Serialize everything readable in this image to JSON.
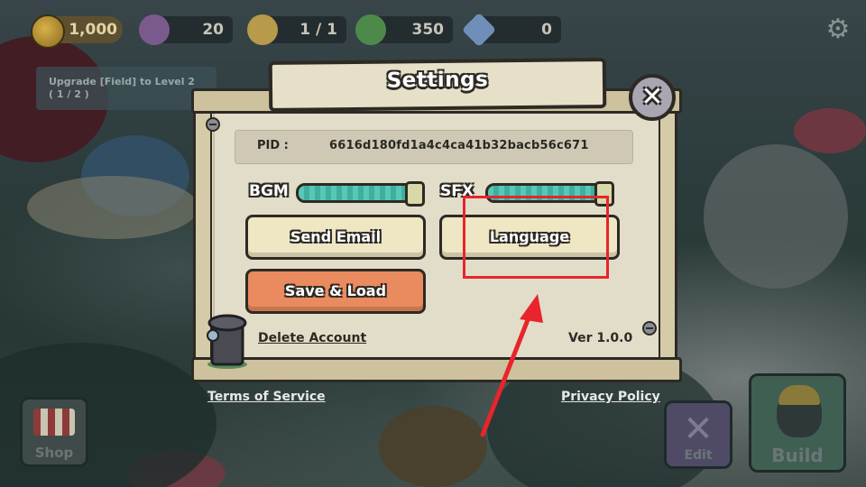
{
  "hud": {
    "gold": "1,000",
    "res2": "20",
    "res3": "1 / 1",
    "res4": "350",
    "gems": "0",
    "quest_line1": "Upgrade [Field] to Level 2",
    "quest_line2": "( 1 / 2 )",
    "icons": [
      "coin-icon",
      "mushroom-resource-icon",
      "villager-icon",
      "sprout-icon",
      "gem-icon",
      "gear-icon"
    ]
  },
  "settings": {
    "title": "Settings",
    "pid_label": "PID :",
    "pid_value": "6616d180fd1a4c4ca41b32bacb56c671",
    "bgm_label": "BGM",
    "sfx_label": "SFX",
    "bgm_level": 1.0,
    "sfx_level": 1.0,
    "send_email": "Send Email",
    "language": "Language",
    "save_load": "Save & Load",
    "delete_account": "Delete Account",
    "version": "Ver 1.0.0"
  },
  "footer": {
    "terms": "Terms of Service",
    "privacy": "Privacy Policy"
  },
  "corner": {
    "shop": "Shop",
    "edit": "Edit",
    "build": "Build"
  },
  "colors": {
    "highlight": "#e8242c",
    "slider_fill": "#4fc4b0",
    "button_cream": "#efe6c3",
    "button_orange": "#e98a5f",
    "panel": "#e2ddc9"
  }
}
